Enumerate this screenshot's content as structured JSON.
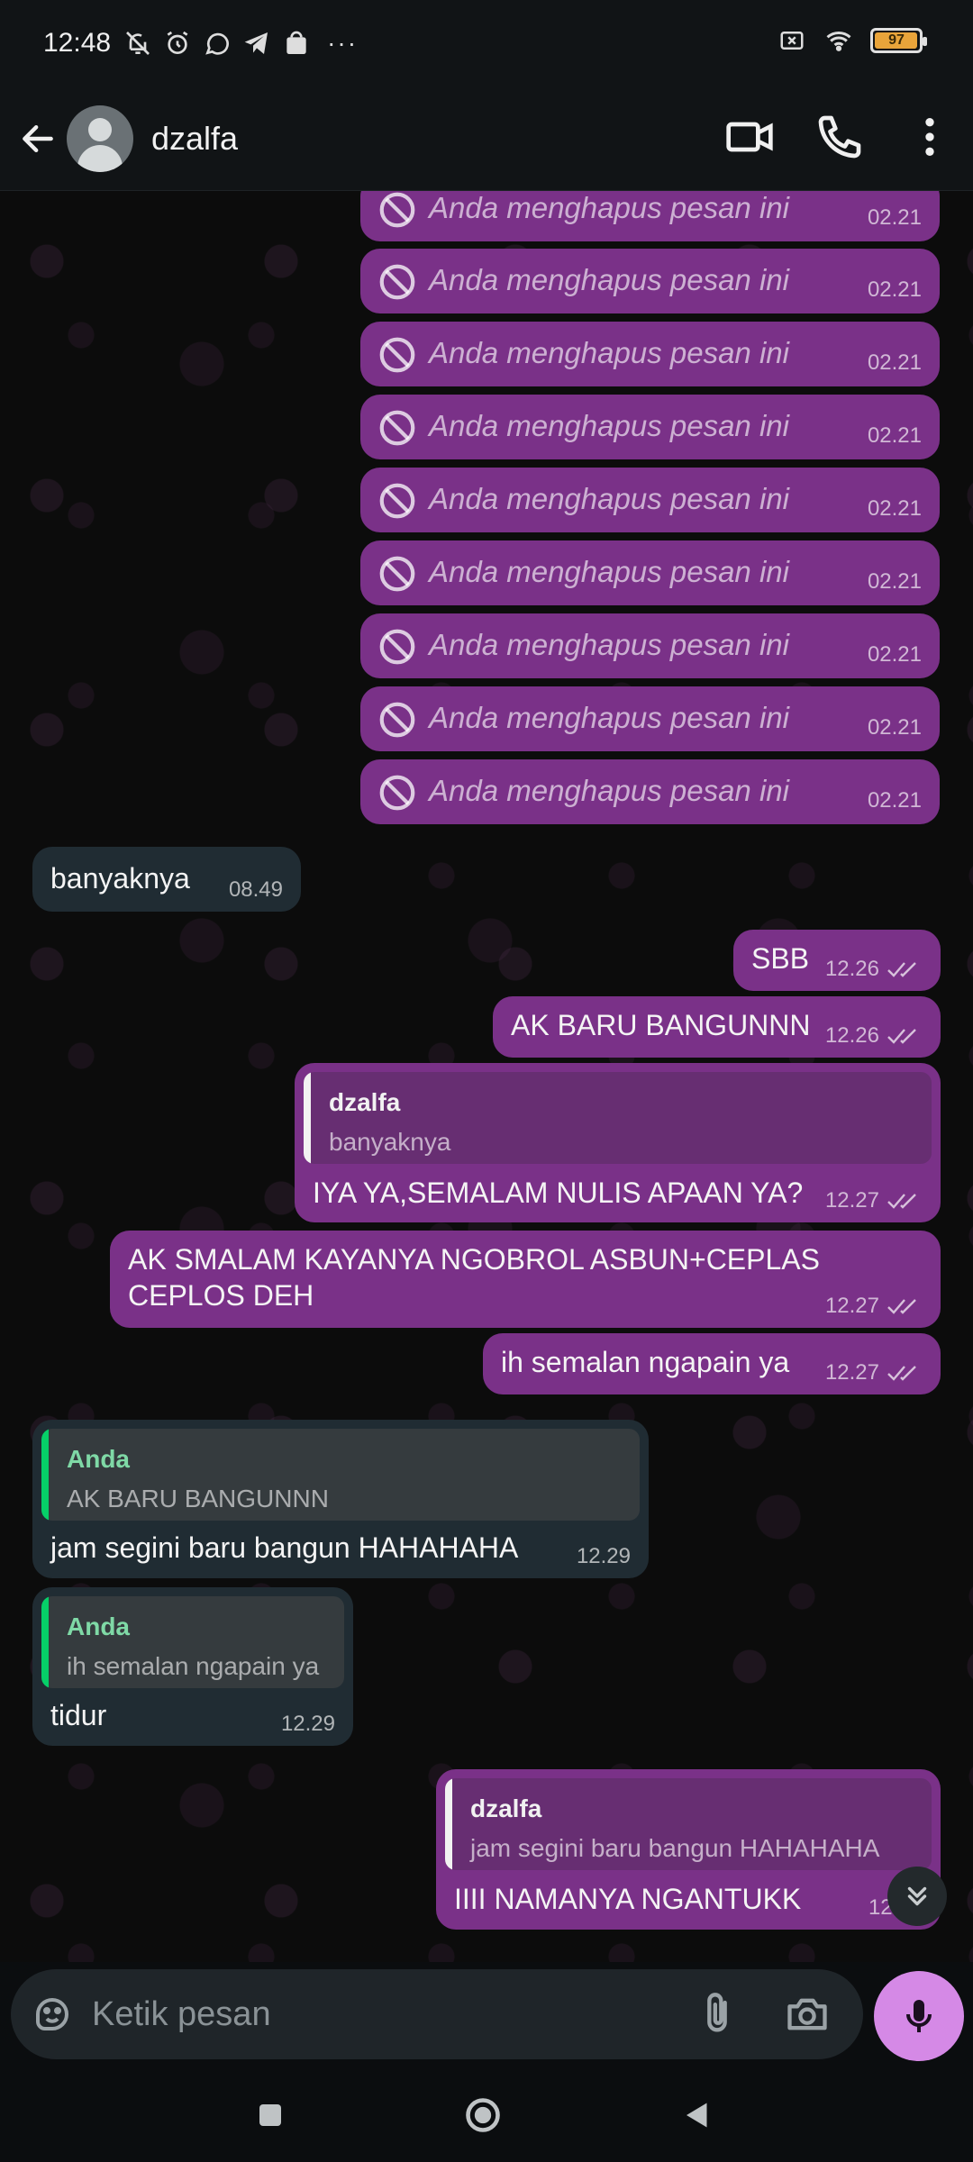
{
  "status_bar": {
    "time": "12:48",
    "more": "···",
    "battery_level": "97"
  },
  "header": {
    "contact_name": "dzalfa"
  },
  "deleted_text": "Anda menghapus pesan ini",
  "deleted_time": "02.21",
  "messages": {
    "m1": {
      "text": "banyaknya",
      "time": "08.49"
    },
    "m2": {
      "text": "SBB",
      "time": "12.26"
    },
    "m3": {
      "text": "AK BARU BANGUNNN",
      "time": "12.26"
    },
    "m4": {
      "quote_author": "dzalfa",
      "quote_text": "banyaknya",
      "text": "IYA YA,SEMALAM NULIS APAAN YA?",
      "time": "12.27"
    },
    "m5": {
      "text_line1": "AK SMALAM KAYANYA NGOBROL ASBUN+CEPLAS",
      "text_line2": "CEPLOS DEH",
      "time": "12.27"
    },
    "m6": {
      "text": "ih semalan ngapain ya",
      "time": "12.27"
    },
    "m7": {
      "quote_author": "Anda",
      "quote_text": "AK BARU BANGUNNN",
      "text": "jam segini baru bangun HAHAHAHA",
      "time": "12.29"
    },
    "m8": {
      "quote_author": "Anda",
      "quote_text": "ih semalan ngapain ya",
      "text": "tidur",
      "time": "12.29"
    },
    "m9": {
      "quote_author": "dzalfa",
      "quote_text": "jam segini baru bangun HAHAHAHA",
      "text": "IIII NAMANYA NGANTUKK",
      "time": "12.30"
    }
  },
  "input": {
    "placeholder": "Ketik pesan"
  },
  "icons": {
    "back": "arrow-left-icon",
    "video": "video-call-icon",
    "call": "phone-icon",
    "menu": "more-vertical-icon",
    "deleted": "prohibited-icon",
    "read": "double-check-icon",
    "scroll": "chevron-double-down-icon",
    "sticker": "sticker-icon",
    "attach": "paperclip-icon",
    "camera": "camera-icon",
    "mic": "microphone-icon"
  },
  "colors": {
    "outgoing_bubble": "#7a3188",
    "incoming_bubble": "#202c33",
    "mic_button": "#d589e6",
    "quote_bar_incoming": "#06cf68"
  }
}
